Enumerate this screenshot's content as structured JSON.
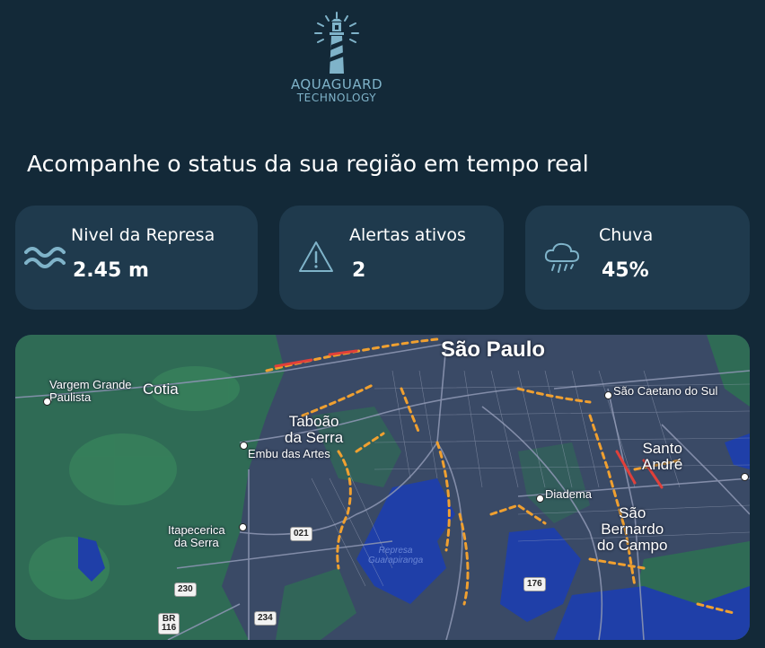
{
  "brand": {
    "line1": "AQUAGUARD",
    "line2": "TECHNOLOGY",
    "accent": "#7fb3c9"
  },
  "headline": "Acompanhe o status da sua região em tempo real",
  "cards": {
    "level": {
      "label": "Nivel da Represa",
      "value": "2.45 m",
      "icon": "water-waves-icon"
    },
    "alerts": {
      "label": "Alertas ativos",
      "value": "2",
      "icon": "warning-triangle-icon"
    },
    "rain": {
      "label": "Chuva",
      "value": "45%",
      "icon": "rain-cloud-icon"
    }
  },
  "map": {
    "labels": {
      "sao_paulo": "São Paulo",
      "cotia": "Cotia",
      "vargem": "Vargem Grande\nPaulista",
      "taboao": "Taboão\nda Serra",
      "embu": "Embu das Artes",
      "itapecerica": "Itapecerica\nda Serra",
      "diadema": "Diadema",
      "sao_caetano": "São Caetano do Sul",
      "santo_andre": "Santo\nAndré",
      "sbc": "São\nBernardo\ndo Campo",
      "represa": "Represa\nGuarapiranga"
    },
    "shields": {
      "r021": "021",
      "r230": "230",
      "r234": "234",
      "r176": "176",
      "br116": "BR\n116"
    },
    "colors": {
      "land": "#3a4a66",
      "forest": "#2f6b55",
      "water": "#1f3fa8",
      "traffic_slow": "#f0a030",
      "traffic_jam": "#e0403a"
    }
  }
}
